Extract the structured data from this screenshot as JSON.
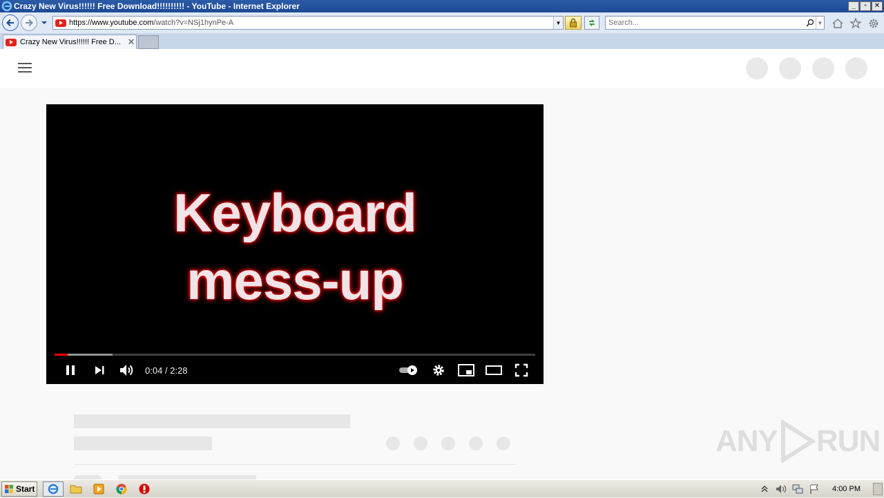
{
  "window": {
    "title": "Crazy New Virus!!!!!! Free Download!!!!!!!!!! - YouTube - Internet Explorer",
    "minimize_label": "_",
    "restore_label": "▫",
    "close_label": "✕"
  },
  "address_bar": {
    "url_prefix": "https://www.youtube.com",
    "url_rest": "/watch?v=NSj1hynPe-A"
  },
  "search": {
    "placeholder": "Search..."
  },
  "tabs": [
    {
      "label": "Crazy New Virus!!!!!! Free D...",
      "close": "✕"
    }
  ],
  "video": {
    "title_line1": "Keyboard",
    "title_line2": "mess-up",
    "current_time": "0:04",
    "separator": " / ",
    "duration": "2:28",
    "played_fraction": 0.027,
    "buffered_fraction": 0.12
  },
  "taskbar": {
    "start_label": "Start",
    "clock": "4:00 PM"
  },
  "watermark": {
    "text_left": "ANY",
    "text_right": "RUN"
  },
  "colors": {
    "youtube_red": "#e62117",
    "progress_red": "#ff0000",
    "glow_red": "#e00000"
  }
}
